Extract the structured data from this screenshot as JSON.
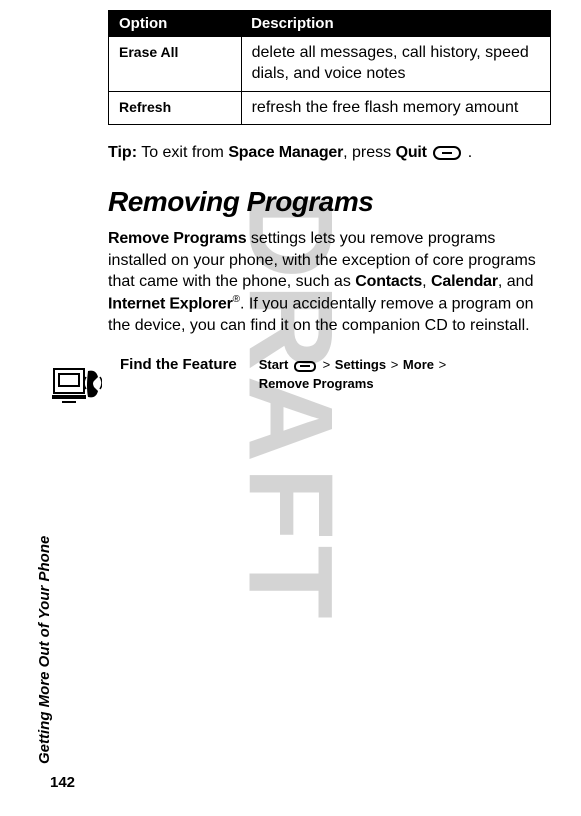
{
  "table": {
    "header": {
      "option": "Option",
      "description": "Description"
    },
    "rows": [
      {
        "option": "Erase All",
        "description": "delete all messages, call history, speed dials, and voice notes"
      },
      {
        "option": "Refresh",
        "description": "refresh the free flash memory amount"
      }
    ]
  },
  "tip": {
    "label": "Tip:",
    "text_before": " To exit from ",
    "app": "Space Manager",
    "text_mid": ", press ",
    "quit": "Quit",
    "text_after": " ."
  },
  "section_heading": "Removing Programs",
  "body": {
    "part1_bold": "Remove Programs",
    "part1_text": " settings lets you remove programs installed on your phone, with the exception of core programs that came with the phone, such as ",
    "contacts": "Contacts",
    "comma1": ", ",
    "calendar": "Calendar",
    "comma2": ", and ",
    "ie": "Internet Explorer",
    "reg": "®",
    "part2_text": ". If you accidentally remove a program on the device, you can find it on the companion CD to reinstall."
  },
  "feature": {
    "label": "Find the Feature",
    "start": "Start",
    "settings": "Settings",
    "more": "More",
    "remove": "Remove Programs",
    "gt": ">"
  },
  "sidebar_text": "Getting More Out of Your Phone",
  "page_number": "142",
  "watermark": "DRAFT"
}
